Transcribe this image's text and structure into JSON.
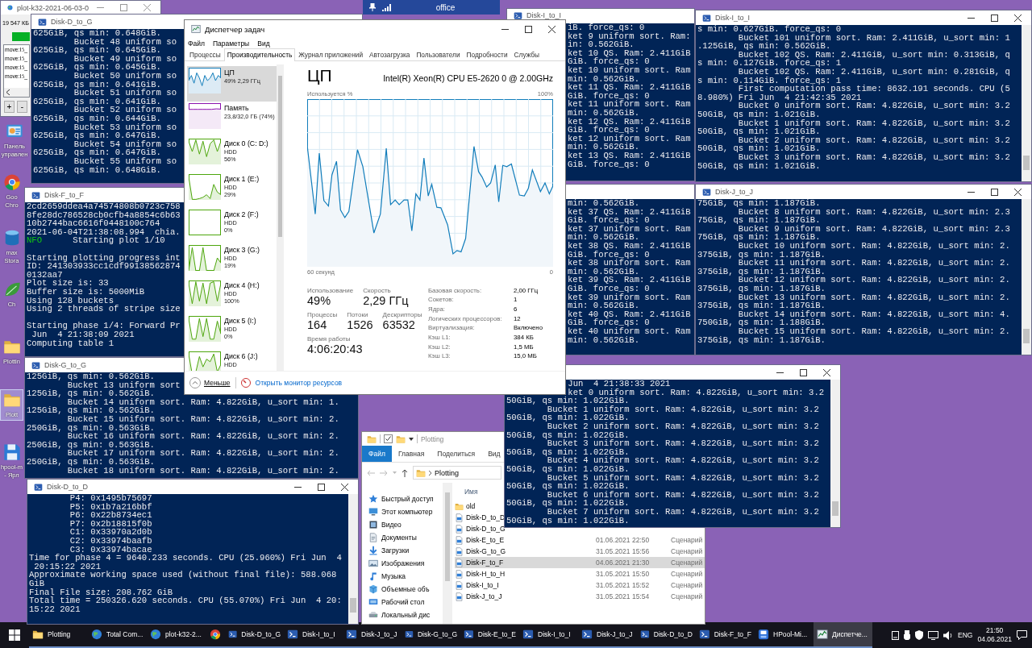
{
  "desktop_icons": [
    {
      "label": "Панель\nуправлен",
      "kind": "control_panel",
      "selected": false
    },
    {
      "label": "Goo\nChro",
      "kind": "chrome",
      "selected": false
    },
    {
      "label": "max\nStora",
      "kind": "storage",
      "selected": false
    },
    {
      "label": "Ch",
      "kind": "leaf",
      "selected": false
    },
    {
      "label": "Plottin",
      "kind": "folder",
      "selected": false
    },
    {
      "label": "Plott",
      "kind": "folder",
      "selected": true
    },
    {
      "label": "hpool-m\n- Ярл",
      "kind": "floppy",
      "selected": false
    }
  ],
  "windows": [
    {
      "kind": "utility",
      "title": "plot-k32-2021-06-03-0",
      "size": "19 547 КБ",
      "level": 1,
      "items": [
        "move:I:\\_",
        "move:I:\\_",
        "move:I:\\_",
        "move:I:\\_"
      ],
      "buttons": [
        "+",
        "-"
      ]
    },
    {
      "kind": "console",
      "title": "Disk-D_to_G",
      "blocks": [
        [
          "625GiB, qs min: 0.648GiB.",
          "        Bucket 48 uniform so",
          "625GiB, qs min: 0.645GiB.",
          "        Bucket 49 uniform so",
          "625GiB, qs min: 0.645GiB.",
          "        Bucket 50 uniform so",
          "625GiB, qs min: 0.641GiB.",
          "        Bucket 51 uniform so",
          "625GiB, qs min: 0.641GiB.",
          "        Bucket 52 uniform so",
          "625GiB, qs min: 0.644GiB.",
          "        Bucket 53 uniform so",
          "625GiB, qs min: 0.647GiB.",
          "        Bucket 54 uniform so",
          "625GiB, qs min: 0.647GiB.",
          "        Bucket 55 uniform so",
          "625GiB, qs min: 0.648GiB."
        ]
      ]
    },
    {
      "kind": "console",
      "title": "Disk-I_to_I",
      "blocks": [
        [
          "iB. force_qs: 0",
          "ket 9 uniform sort. Ram:",
          "in: 0.562GiB.",
          "ket 10 QS. Ram: 2.411GiB",
          "GiB. force_qs: 0",
          "ket 10 uniform sort. Ram",
          "min: 0.562GiB.",
          "ket 11 QS. Ram: 2.411GiB",
          "GiB. force_qs: 0",
          "ket 11 uniform sort. Ram",
          "min: 0.562GiB.",
          "ket 12 QS. Ram: 2.411GiB",
          "GiB. force_qs: 0",
          "ket 12 uniform sort. Ram",
          "min: 0.562GiB.",
          "ket 13 QS. Ram: 2.411GiB",
          "GiB. force_qs: 0"
        ]
      ]
    },
    {
      "kind": "console",
      "title": "Disk-I_to_I",
      "blocks": [
        [
          "s min: 0.627GiB. force_qs: 0",
          "        Bucket 101 uniform sort. Ram: 2.411GiB, u_sort min: 1",
          ".125GiB, qs min: 0.562GiB.",
          "        Bucket 102 QS. Ram: 2.411GiB, u_sort min: 0.313GiB, q",
          "s min: 0.127GiB. force_qs: 1",
          "        Bucket 102 QS. Ram: 2.411GiB, u_sort min: 0.281GiB, q",
          "s min: 0.114GiB. force_qs: 1",
          "        First computation pass time: 8632.191 seconds. CPU (5",
          "8.980%) Fri Jun  4 21:42:35 2021",
          "        Bucket 0 uniform sort. Ram: 4.822GiB, u_sort min: 3.2",
          "50GiB, qs min: 1.021GiB.",
          "        Bucket 1 uniform sort. Ram: 4.822GiB, u_sort min: 3.2",
          "50GiB, qs min: 1.021GiB.",
          "        Bucket 2 uniform sort. Ram: 4.822GiB, u_sort min: 3.2",
          "50GiB, qs min: 1.021GiB.",
          "        Bucket 3 uniform sort. Ram: 4.822GiB, u_sort min: 3.2",
          "50GiB, qs min: 1.021GiB."
        ]
      ]
    },
    {
      "kind": "console",
      "title": "Disk-F_to_F",
      "blocks": [
        [
          "2cd2659ddea4a74574808b0723c758",
          "8fe28dc786528cb0cfb4a8854c6b63",
          "10b2744bac6616f0448100c764",
          "2021-06-04T21:38:08.994  chia.",
          {
            "tag": "NFO",
            "text": "      Starting plot 1/10"
          }
        ],
        [
          "Starting plotting progress int",
          "ID: 241303933cc1cdf99138562874",
          "0132aa7",
          "Plot size is: 33",
          "Buffer size is: 5000MiB",
          "Using 128 buckets",
          "Using 2 threads of stripe size"
        ],
        [
          "Starting phase 1/4: Forward Pr",
          " Jun  4 21:38:09 2021",
          "Computing table 1"
        ]
      ]
    },
    {
      "kind": "console",
      "blocks": [
        [
          "min: 0.562GiB.",
          "ket 37 QS. Ram: 2.411GiB",
          "GiB. force_qs: 0",
          "ket 37 uniform sort. Ram",
          "min: 0.562GiB.",
          "ket 38 QS. Ram: 2.411GiB",
          "GiB. force_qs: 0",
          "ket 38 uniform sort. Ram",
          "min: 0.562GiB.",
          "ket 39 QS. Ram: 2.411GiB",
          "GiB. force_qs: 0",
          "ket 39 uniform sort. Ram",
          "min: 0.562GiB.",
          "ket 40 QS. Ram: 2.411GiB",
          "GiB. force_qs: 0",
          "ket 40 uniform sort. Ram",
          "min: 0.562GiB."
        ]
      ]
    },
    {
      "kind": "console",
      "title": "Disk-J_to_J",
      "blocks": [
        [
          "75GiB, qs min: 1.187GiB.",
          "        Bucket 8 uniform sort. Ram: 4.822GiB, u_sort min: 2.3",
          "75GiB, qs min: 1.187GiB.",
          "        Bucket 9 uniform sort. Ram: 4.822GiB, u_sort min: 2.3",
          "75GiB, qs min: 1.187GiB.",
          "        Bucket 10 uniform sort. Ram: 4.822GiB, u_sort min: 2.",
          "375GiB, qs min: 1.187GiB.",
          "        Bucket 11 uniform sort. Ram: 4.822GiB, u_sort min: 2.",
          "375GiB, qs min: 1.187GiB.",
          "        Bucket 12 uniform sort. Ram: 4.822GiB, u_sort min: 2.",
          "375GiB, qs min: 1.187GiB.",
          "        Bucket 13 uniform sort. Ram: 4.822GiB, u_sort min: 2.",
          "375GiB, qs min: 1.187GiB.",
          "        Bucket 14 uniform sort. Ram: 4.822GiB, u_sort min: 4.",
          "750GiB, qs min: 1.188GiB.",
          "        Bucket 15 uniform sort. Ram: 4.822GiB, u_sort min: 2.",
          "375GiB, qs min: 1.187GiB."
        ]
      ]
    },
    {
      "kind": "console",
      "title": "Disk-G_to_G",
      "blocks": [
        [
          "125GiB, qs min: 0.562GiB.",
          "        Bucket 13 uniform sort",
          "125GiB, qs min: 0.562GiB.",
          "        Bucket 14 uniform sort. Ram: 4.822GiB, u_sort min: 1.",
          "125GiB, qs min: 0.562GiB.",
          "        Bucket 15 uniform sort. Ram: 4.822GiB, u_sort min: 2.",
          "250GiB, qs min: 0.563GiB.",
          "        Bucket 16 uniform sort. Ram: 4.822GiB, u_sort min: 2.",
          "250GiB, qs min: 0.563GiB.",
          "        Bucket 17 uniform sort. Ram: 4.822GiB, u_sort min: 2.",
          "250GiB, qs min: 0.563GiB.",
          "        Bucket 18 uniform sort. Ram: 4.822GiB, u_sort min: 2."
        ]
      ]
    },
    {
      "kind": "console",
      "blocks": [
        [
          "            Jun  4 21:38:33 2021",
          "            ket 0 uniform sort. Ram: 4.822GiB, u_sort min: 3.2",
          "50GiB, qs min: 1.022GiB.",
          "        Bucket 1 uniform sort. Ram: 4.822GiB, u_sort min: 3.2",
          "50GiB, qs min: 1.022GiB.",
          "        Bucket 2 uniform sort. Ram: 4.822GiB, u_sort min: 3.2",
          "50GiB, qs min: 1.022GiB.",
          "        Bucket 3 uniform sort. Ram: 4.822GiB, u_sort min: 3.2",
          "50GiB, qs min: 1.022GiB.",
          "        Bucket 4 uniform sort. Ram: 4.822GiB, u_sort min: 3.2",
          "50GiB, qs min: 1.022GiB.",
          "        Bucket 5 uniform sort. Ram: 4.822GiB, u_sort min: 3.2",
          "50GiB, qs min: 1.022GiB.",
          "        Bucket 6 uniform sort. Ram: 4.822GiB, u_sort min: 3.2",
          "50GiB, qs min: 1.022GiB.",
          "        Bucket 7 uniform sort. Ram: 4.822GiB, u_sort min: 3.2",
          "50GiB, qs min: 1.022GiB."
        ]
      ]
    },
    {
      "kind": "explorer",
      "title": "Plotting",
      "ribbon": [
        {
          "label": "Файл",
          "selected": true
        },
        {
          "label": "Главная",
          "selected": false
        },
        {
          "label": "Поделиться",
          "selected": false
        },
        {
          "label": "Вид",
          "selected": false
        }
      ],
      "address": "Plotting",
      "nav": [
        {
          "label": "Быстрый доступ",
          "kind": "star"
        },
        {
          "label": "Этот компьютер",
          "kind": "pc"
        },
        {
          "label": "Видео",
          "kind": "video"
        },
        {
          "label": "Документы",
          "kind": "docs"
        },
        {
          "label": "Загрузки",
          "kind": "download"
        },
        {
          "label": "Изображения",
          "kind": "pictures"
        },
        {
          "label": "Музыка",
          "kind": "music"
        },
        {
          "label": "Объемные объ",
          "kind": "cube"
        },
        {
          "label": "Рабочий стол",
          "kind": "desktop"
        },
        {
          "label": "Локальный дис",
          "kind": "drive"
        }
      ],
      "column": "Имя",
      "files": [
        {
          "name": "old",
          "kind": "folder",
          "selected": false
        },
        {
          "name": "Disk-D_to_D",
          "kind": "script",
          "selected": false
        },
        {
          "name": "Disk-D_to_G",
          "kind": "script",
          "selected": false
        },
        {
          "name": "Disk-E_to_E",
          "kind": "script",
          "date": "01.06.2021 22:50",
          "type": "Сценарий",
          "selected": false
        },
        {
          "name": "Disk-G_to_G",
          "kind": "script",
          "date": "31.05.2021 15:56",
          "type": "Сценарий",
          "selected": false
        },
        {
          "name": "Disk-F_to_F",
          "kind": "script",
          "date": "04.06.2021 21:30",
          "type": "Сценарий",
          "selected": true
        },
        {
          "name": "Disk-H_to_H",
          "kind": "script",
          "date": "31.05.2021 15:50",
          "type": "Сценарий",
          "selected": false
        },
        {
          "name": "Disk-I_to_I",
          "kind": "script",
          "date": "31.05.2021 15:52",
          "type": "Сценарий",
          "selected": false
        },
        {
          "name": "Disk-J_to_J",
          "kind": "script",
          "date": "31.05.2021 15:54",
          "type": "Сценарий",
          "selected": false
        }
      ]
    },
    {
      "kind": "console",
      "title": "Disk-D_to_D",
      "blocks": [
        [
          "        P4: 0x1495b75697",
          "        P5: 0x1b7a216bbf",
          "        P6: 0x22b8734ec1",
          "        P7: 0x2b18815f0b",
          "        C1: 0x33970a2d0b",
          "        C2: 0x33974baafb",
          "        C3: 0x33974bacae",
          "Time for phase 4 = 9640.233 seconds. CPU (25.960%) Fri Jun  4",
          " 20:15:22 2021",
          "Approximate working space used (without final file): 588.068",
          "GiB",
          "Final File size: 208.762 GiB",
          "Total time = 250326.620 seconds. CPU (55.070%) Fri Jun  4 20:",
          "15:22 2021"
        ]
      ]
    },
    {
      "kind": "task_manager",
      "title": "Диспетчер задач",
      "menu": [
        "Файл",
        "Параметры",
        "Вид"
      ],
      "tabs": [
        {
          "label": "Процессы",
          "selected": false
        },
        {
          "label": "Производительность",
          "selected": true
        },
        {
          "label": "Журнал приложений",
          "selected": false
        },
        {
          "label": "Автозагрузка",
          "selected": false
        },
        {
          "label": "Пользователи",
          "selected": false
        },
        {
          "label": "Подробности",
          "selected": false
        },
        {
          "label": "Службы",
          "selected": false
        }
      ],
      "sidebar": [
        {
          "kind": "cpu",
          "name": "ЦП",
          "detail": "49% 2,29 ГГц",
          "selected": true
        },
        {
          "kind": "memory",
          "name": "Память",
          "detail": "23,8/32,0 ГБ (74%)",
          "selected": false
        },
        {
          "kind": "disk",
          "name": "Диск 0 (C: D:)",
          "type": "HDD",
          "detail": "56%",
          "selected": false
        },
        {
          "kind": "disk",
          "name": "Диск 1 (E:)",
          "type": "HDD",
          "detail": "29%",
          "selected": false
        },
        {
          "kind": "disk",
          "name": "Диск 2 (F:)",
          "type": "HDD",
          "detail": "0%",
          "selected": false
        },
        {
          "kind": "disk",
          "name": "Диск 3 (G:)",
          "type": "HDD",
          "detail": "19%",
          "selected": false
        },
        {
          "kind": "disk",
          "name": "Диск 4 (H:)",
          "type": "HDD",
          "detail": "100%",
          "selected": false
        },
        {
          "kind": "disk",
          "name": "Диск 5 (I:)",
          "type": "HDD",
          "detail": "0%",
          "selected": false
        },
        {
          "kind": "disk",
          "name": "Диск 6 (J:)",
          "type": "HDD",
          "selected": false
        }
      ],
      "heading": "ЦП",
      "model": "Intel(R) Xeon(R) CPU E5-2620 0 @ 2.00GHz",
      "graph_label": "Используется %",
      "graph_max": "100%",
      "graph_span": "60 секунд",
      "graph_min": "0",
      "stats": [
        [
          {
            "label": "Использование",
            "value": "49%"
          },
          {
            "label": "Скорость",
            "value": "2,29 ГГц"
          }
        ],
        [
          {
            "label": "Процессы",
            "value": "164"
          },
          {
            "label": "Потоки",
            "value": "1526"
          },
          {
            "label": "Дескрипторы",
            "value": "63532"
          }
        ],
        [
          {
            "label": "Время работы",
            "value": "4:06:20:43"
          }
        ]
      ],
      "specs": [
        {
          "label": "Базовая скорость:",
          "value": "2,00 ГГц"
        },
        {
          "label": "Сокетов:",
          "value": "1"
        },
        {
          "label": "Ядра:",
          "value": "6"
        },
        {
          "label": "Логических процессоров:",
          "value": "12"
        },
        {
          "label": "Виртуализация:",
          "value": "Включено"
        },
        {
          "label": "Кэш L1:",
          "value": "384 КБ"
        },
        {
          "label": "Кэш L2:",
          "value": "1,5 МБ"
        },
        {
          "label": "Кэш L3:",
          "value": "15,0 МБ"
        }
      ],
      "less": "Меньше",
      "monitor_link": "Открыть монитор ресурсов"
    }
  ],
  "connection_bar": {
    "title": "office"
  },
  "taskbar": {
    "items": [
      {
        "label": "Plotting",
        "kind": "folder",
        "selected": false
      },
      {
        "label": "Total Com...",
        "kind": "globe",
        "selected": false
      },
      {
        "label": "plot-k32-2...",
        "kind": "globe",
        "selected": false
      },
      {
        "kind": "chrome",
        "selected": false
      },
      {
        "label": "Disk-D_to_G",
        "kind": "terminal",
        "selected": false
      },
      {
        "label": "Disk-I_to_I",
        "kind": "terminal",
        "selected": false
      },
      {
        "label": "Disk-J_to_J",
        "kind": "terminal",
        "selected": false
      },
      {
        "label": "Disk-G_to_G",
        "kind": "terminal",
        "selected": false
      },
      {
        "label": "Disk-E_to_E",
        "kind": "terminal",
        "selected": false
      },
      {
        "label": "Disk-I_to_I",
        "kind": "terminal",
        "selected": false
      },
      {
        "label": "Disk-J_to_J",
        "kind": "terminal",
        "selected": false
      },
      {
        "label": "Disk-D_to_D",
        "kind": "terminal",
        "selected": false
      },
      {
        "label": "Disk-F_to_F",
        "kind": "terminal",
        "selected": false
      },
      {
        "label": "HPool-Mi...",
        "kind": "app",
        "selected": false
      },
      {
        "label": "Диспетче...",
        "kind": "taskmgr",
        "selected": true
      }
    ],
    "language": "ENG",
    "time": "21:50",
    "date": "04.06.2021"
  }
}
